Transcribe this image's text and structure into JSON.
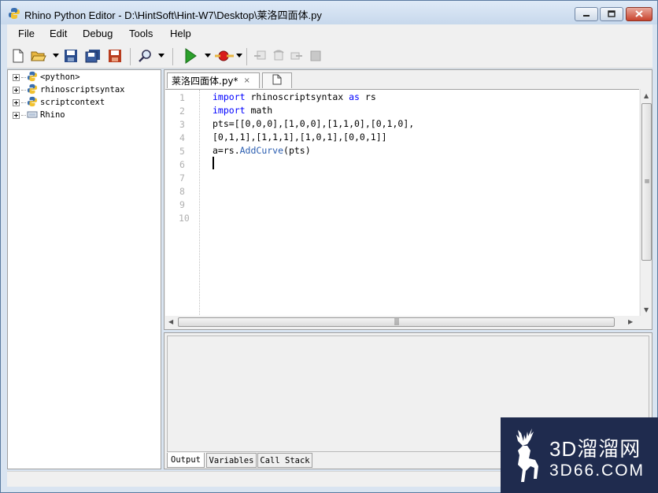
{
  "window": {
    "title": "Rhino Python Editor - D:\\HintSoft\\Hint-W7\\Desktop\\莱洛四面体.py"
  },
  "menu": [
    "File",
    "Edit",
    "Debug",
    "Tools",
    "Help"
  ],
  "toolbar": {
    "icons": [
      "new-file-icon",
      "open-folder-icon",
      "save-icon",
      "save-all-icon",
      "save-as-icon",
      "find-icon",
      "run-icon",
      "debug-breakpoint-icon",
      "step-into-icon",
      "step-over-icon",
      "step-out-icon",
      "stop-icon"
    ],
    "accent": "#2ba02b"
  },
  "tree": {
    "items": [
      {
        "label": "<python>",
        "icon": "python-icon"
      },
      {
        "label": "rhinoscriptsyntax",
        "icon": "python-icon"
      },
      {
        "label": "scriptcontext",
        "icon": "python-icon"
      },
      {
        "label": "Rhino",
        "icon": "dll-icon"
      }
    ]
  },
  "editor": {
    "tab_label": "莱洛四面体.py*",
    "tab_close": "×",
    "line_numbers": [
      "1",
      "2",
      "3",
      "4",
      "5",
      "6",
      "7",
      "8",
      "9",
      "10"
    ],
    "lines": [
      {
        "kw1": "import",
        "rest": " rhinoscriptsyntax ",
        "kw2": "as",
        "tail": " rs"
      },
      {
        "kw1": "import",
        "rest": " math"
      },
      {
        "text": "pts=[[0,0,0],[1,0,0],[1,1,0],[0,1,0],"
      },
      {
        "text": "[0,1,1],[1,1,1],[1,0,1],[0,0,1]]"
      },
      {
        "pre": "a=rs.",
        "method": "AddCurve",
        "post": "(pts)"
      }
    ],
    "keyword_color": "#0000ff"
  },
  "output": {
    "tabs": [
      "Output",
      "Variables",
      "Call Stack"
    ],
    "active_tab": "Output"
  },
  "watermark": {
    "line1": "3D溜溜网",
    "line2": "3D66.COM"
  }
}
